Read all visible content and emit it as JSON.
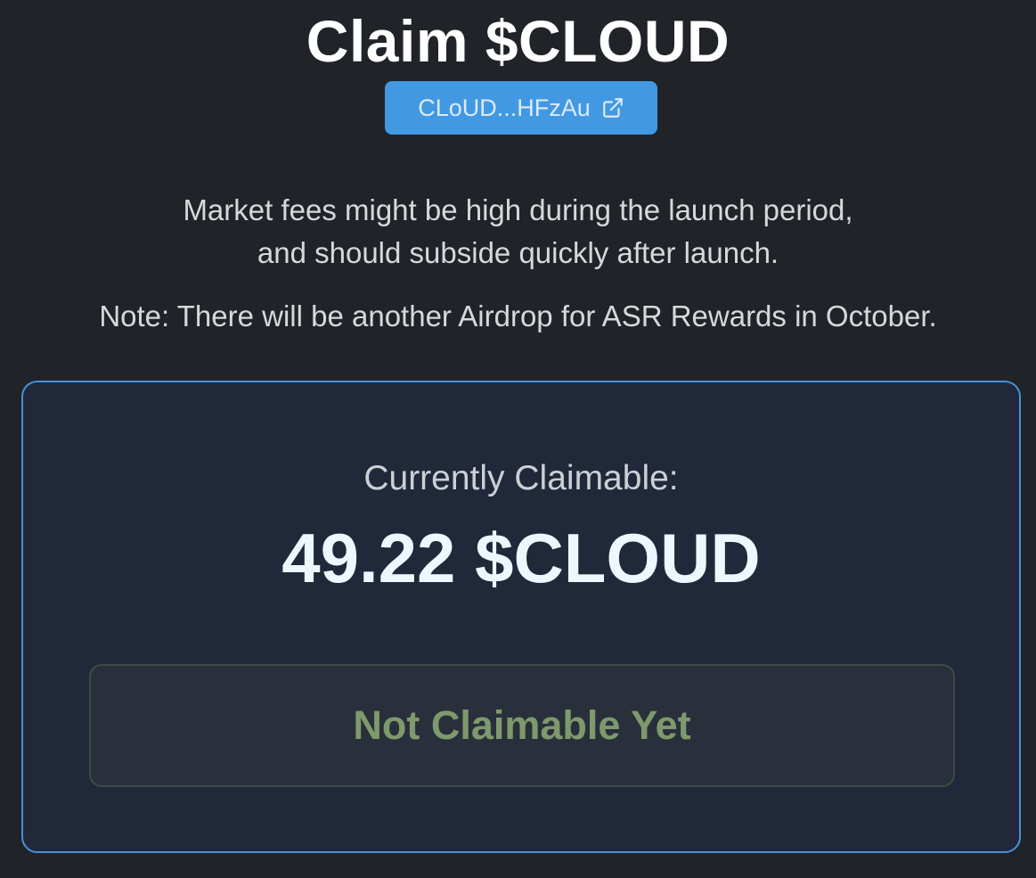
{
  "header": {
    "title": "Claim $CLOUD",
    "address_short": "CLoUD...HFzAu",
    "address_icon": "external-link-icon"
  },
  "info": {
    "line1": "Market fees might be high during the launch period,",
    "line2": "and should subside quickly after launch.",
    "note": "Note: There will be another Airdrop for ASR Rewards in October."
  },
  "claim": {
    "label": "Currently Claimable:",
    "amount": "49.22 $CLOUD",
    "button_label": "Not Claimable Yet",
    "button_state": "disabled"
  },
  "colors": {
    "background": "#202328",
    "accent": "#4299e1",
    "card_border": "#4a90d9",
    "disabled_text": "#7e9a6d"
  }
}
